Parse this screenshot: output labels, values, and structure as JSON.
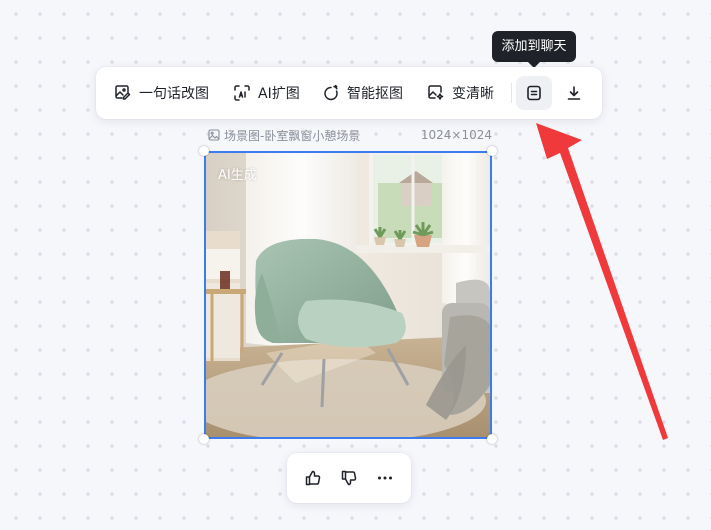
{
  "tooltip": {
    "text": "添加到聊天"
  },
  "toolbar": {
    "items": [
      {
        "label": "一句话改图",
        "icon": "image-edit-icon"
      },
      {
        "label": "AI扩图",
        "icon": "ai-expand-icon"
      },
      {
        "label": "智能抠图",
        "icon": "smart-cutout-icon"
      },
      {
        "label": "变清晰",
        "icon": "enhance-icon"
      }
    ],
    "add_to_chat_icon": "chat-add-icon",
    "download_icon": "download-icon"
  },
  "image": {
    "title": "场景图-卧室飘窗小憩场景",
    "dimensions": "1024×1024",
    "badge": "AI生成"
  },
  "feedback": {
    "like_icon": "thumbs-up-icon",
    "dislike_icon": "thumbs-down-icon",
    "more_icon": "more-icon"
  },
  "colors": {
    "selection": "#3c7cf0",
    "annotation_arrow": "#f0393b",
    "tooltip_bg": "#1f2329"
  }
}
